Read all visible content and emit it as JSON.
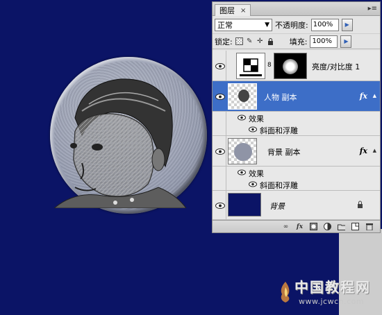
{
  "panel": {
    "tab_label": "图层",
    "tab_close": "×",
    "menu_icon": "panel-menu-icon",
    "blend_mode": "正常",
    "opacity_label": "不透明度:",
    "opacity_value": "100%",
    "lock_label": "锁定:",
    "fill_label": "填充:",
    "fill_value": "100%",
    "layers": [
      {
        "name": "亮度/对比度 1",
        "type": "adjustment",
        "visible": true
      },
      {
        "name": "人物 副本",
        "type": "pixel",
        "visible": true,
        "selected": true,
        "fx": "fx",
        "effects_label": "效果",
        "effects": [
          "斜面和浮雕"
        ]
      },
      {
        "name": "背景 副本",
        "type": "pixel",
        "visible": true,
        "fx": "fx",
        "effects_label": "效果",
        "effects": [
          "斜面和浮雕"
        ]
      },
      {
        "name": "背景",
        "type": "background",
        "visible": true,
        "locked": true
      }
    ],
    "bottom_icons": [
      "link-icon",
      "fx-icon",
      "mask-icon",
      "adjustment-icon",
      "group-icon",
      "new-layer-icon",
      "trash-icon"
    ]
  },
  "watermark": {
    "title": "中国教程网",
    "url": "www.jcwcn.com"
  },
  "colors": {
    "canvas_bg": "#0b1466",
    "selection": "#3d6ec7",
    "panel_bg": "#e4e4e4"
  }
}
